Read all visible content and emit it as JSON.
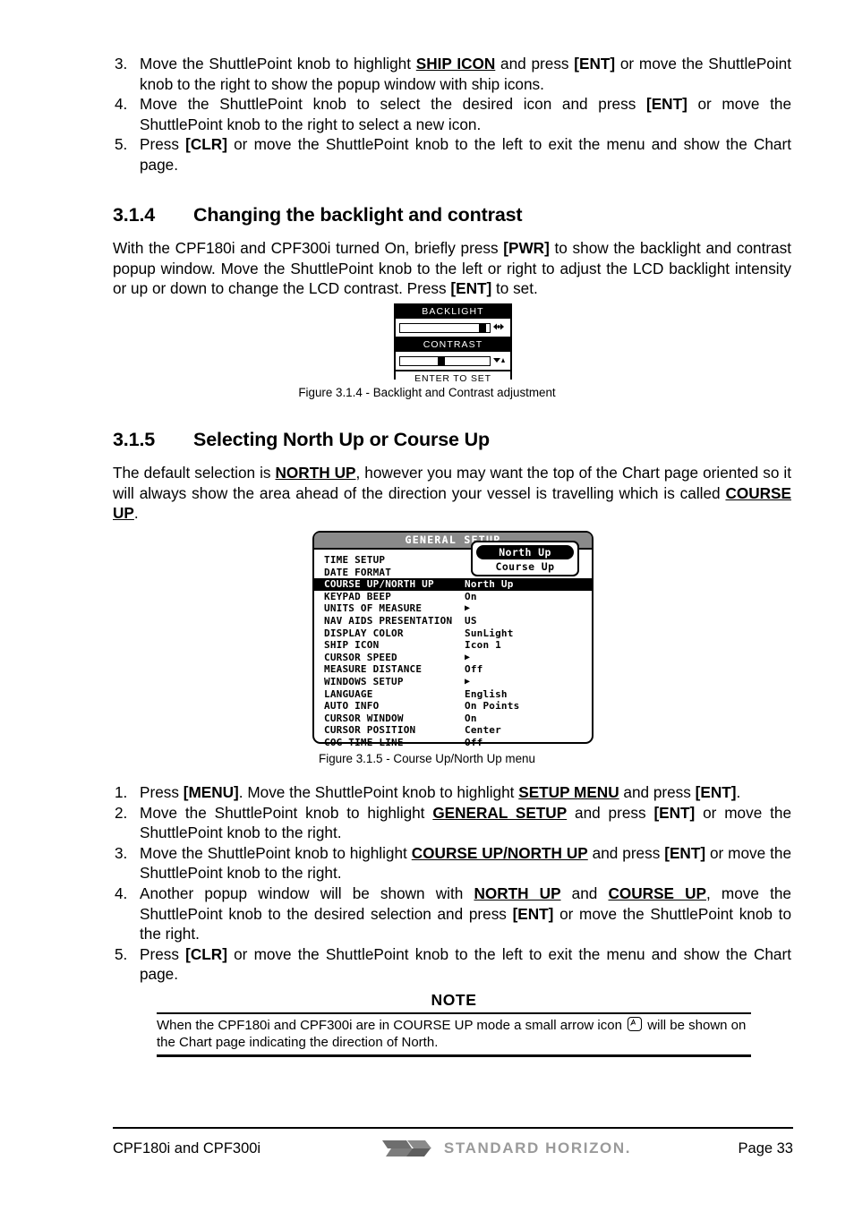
{
  "top_list": {
    "items": [
      {
        "marker": "3.",
        "segments": [
          {
            "t": "Move the ShuttlePoint knob to highlight ",
            "s": "normal"
          },
          {
            "t": "SHIP ICON",
            "s": "underline-bold"
          },
          {
            "t": " and press ",
            "s": "normal"
          },
          {
            "t": "[ENT]",
            "s": "bold"
          },
          {
            "t": " or move the ShuttlePoint knob to the right to show the popup window with ship icons.",
            "s": "normal"
          }
        ]
      },
      {
        "marker": "4.",
        "segments": [
          {
            "t": "Move the ShuttlePoint knob to select the desired icon and press ",
            "s": "normal"
          },
          {
            "t": "[ENT]",
            "s": "bold"
          },
          {
            "t": " or move the ShuttlePoint knob to the right to select a new icon.",
            "s": "normal"
          }
        ]
      },
      {
        "marker": "5.",
        "segments": [
          {
            "t": "Press ",
            "s": "normal"
          },
          {
            "t": "[CLR]",
            "s": "bold"
          },
          {
            "t": " or move the ShuttlePoint knob to the left to exit the menu and show the Chart page.",
            "s": "normal"
          }
        ]
      }
    ]
  },
  "section_314": {
    "number": "3.1.4",
    "title": "Changing the backlight and contrast",
    "paragraph": [
      {
        "t": "With the CPF180i and CPF300i turned On, briefly press ",
        "s": "normal"
      },
      {
        "t": "[PWR]",
        "s": "bold"
      },
      {
        "t": " to show the backlight and contrast popup window. Move the ShuttlePoint knob to the left or right to adjust the LCD backlight intensity or up or down to change the LCD contrast. Press ",
        "s": "normal"
      },
      {
        "t": "[ENT]",
        "s": "bold"
      },
      {
        "t": " to set.",
        "s": "normal"
      }
    ]
  },
  "backlight_figure": {
    "backlight_title": "BACKLIGHT",
    "backlight_knob_percent": 92,
    "backlight_side_icon": "brightness-icon",
    "contrast_title": "CONTRAST",
    "contrast_knob_percent": 46,
    "contrast_side_icon": "contrast-icon",
    "footer_label": "ENTER TO SET",
    "caption": "Figure 3.1.4 - Backlight and Contrast adjustment"
  },
  "section_315": {
    "number": "3.1.5",
    "title": "Selecting North Up or Course Up",
    "paragraph": [
      {
        "t": "The default selection is ",
        "s": "normal"
      },
      {
        "t": "NORTH UP",
        "s": "underline-bold"
      },
      {
        "t": ", however you may want the top of the Chart page oriented so it will always show the area ahead of the direction your vessel is travelling which is called ",
        "s": "normal"
      },
      {
        "t": "COURSE  UP",
        "s": "underline-bold"
      },
      {
        "t": ".",
        "s": "normal"
      }
    ]
  },
  "general_setup": {
    "title": "GENERAL SETUP",
    "rows": [
      {
        "label": "TIME SETUP",
        "value": "",
        "selected": false,
        "arrow": false
      },
      {
        "label": "DATE FORMAT",
        "value": "",
        "selected": false,
        "arrow": false
      },
      {
        "label": "COURSE UP/NORTH UP",
        "value": "North Up",
        "selected": true,
        "arrow": false
      },
      {
        "label": "KEYPAD BEEP",
        "value": "On",
        "selected": false,
        "arrow": false
      },
      {
        "label": "UNITS OF MEASURE",
        "value": "",
        "selected": false,
        "arrow": true
      },
      {
        "label": "NAV AIDS PRESENTATION",
        "value": "US",
        "selected": false,
        "arrow": false
      },
      {
        "label": "DISPLAY COLOR",
        "value": "SunLight",
        "selected": false,
        "arrow": false
      },
      {
        "label": "SHIP ICON",
        "value": "Icon 1",
        "selected": false,
        "arrow": false
      },
      {
        "label": "CURSOR SPEED",
        "value": "",
        "selected": false,
        "arrow": true
      },
      {
        "label": "MEASURE DISTANCE",
        "value": "Off",
        "selected": false,
        "arrow": false
      },
      {
        "label": "WINDOWS SETUP",
        "value": "",
        "selected": false,
        "arrow": true
      },
      {
        "label": "LANGUAGE",
        "value": "English",
        "selected": false,
        "arrow": false
      },
      {
        "label": "AUTO INFO",
        "value": "On Points",
        "selected": false,
        "arrow": false
      },
      {
        "label": "CURSOR WINDOW",
        "value": "On",
        "selected": false,
        "arrow": false
      },
      {
        "label": "CURSOR POSITION",
        "value": "Center",
        "selected": false,
        "arrow": false
      },
      {
        "label": "COG TIME LINE",
        "value": "Off",
        "selected": false,
        "arrow": false
      }
    ],
    "popup": {
      "options": [
        {
          "label": "North Up",
          "selected": true
        },
        {
          "label": "Course Up",
          "selected": false
        }
      ]
    },
    "caption": "Figure 3.1.5 - Course Up/North Up menu"
  },
  "bottom_list": {
    "items": [
      {
        "marker": "1.",
        "segments": [
          {
            "t": "Press ",
            "s": "normal"
          },
          {
            "t": "[MENU]",
            "s": "bold"
          },
          {
            "t": ". Move the ShuttlePoint knob to highlight ",
            "s": "normal"
          },
          {
            "t": "SETUP MENU",
            "s": "underline-bold"
          },
          {
            "t": " and press ",
            "s": "normal"
          },
          {
            "t": "[ENT]",
            "s": "bold"
          },
          {
            "t": ".",
            "s": "normal"
          }
        ]
      },
      {
        "marker": "2.",
        "segments": [
          {
            "t": "Move the ShuttlePoint knob to highlight ",
            "s": "normal"
          },
          {
            "t": "GENERAL SETUP",
            "s": "underline-bold"
          },
          {
            "t": " and press ",
            "s": "normal"
          },
          {
            "t": "[ENT]",
            "s": "bold"
          },
          {
            "t": " or move the ShuttlePoint knob to the right.",
            "s": "normal"
          }
        ]
      },
      {
        "marker": "3.",
        "segments": [
          {
            "t": "Move the ShuttlePoint knob to highlight  ",
            "s": "normal"
          },
          {
            "t": "COURSE UP/NORTH UP",
            "s": "underline-bold"
          },
          {
            "t": " and press ",
            "s": "normal"
          },
          {
            "t": "[ENT]",
            "s": "bold"
          },
          {
            "t": " or move the ShuttlePoint knob to the right.",
            "s": "normal"
          }
        ]
      },
      {
        "marker": "4.",
        "segments": [
          {
            "t": "Another popup window will be shown with ",
            "s": "normal"
          },
          {
            "t": "NORTH UP",
            "s": "underline-bold"
          },
          {
            "t": " and ",
            "s": "normal"
          },
          {
            "t": "COURSE UP",
            "s": "underline-bold"
          },
          {
            "t": ", move the ShuttlePoint knob to the desired selection and press ",
            "s": "normal"
          },
          {
            "t": "[ENT]",
            "s": "bold"
          },
          {
            "t": " or move the ShuttlePoint knob to the right.",
            "s": "normal"
          }
        ]
      },
      {
        "marker": "5.",
        "segments": [
          {
            "t": "Press ",
            "s": "normal"
          },
          {
            "t": "[CLR]",
            "s": "bold"
          },
          {
            "t": " or move the ShuttlePoint knob to the left to exit the menu and show the Chart page.",
            "s": "normal"
          }
        ]
      }
    ]
  },
  "note": {
    "title": "NOTE",
    "body_before_icon": "When the CPF180i and CPF300i are in COURSE UP mode a small arrow  icon ",
    "icon_name": "north-arrow-icon",
    "body_after_icon": " will be shown on the Chart page indicating the direction of North."
  },
  "footer": {
    "left": "CPF180i and CPF300i",
    "logo_text": "STANDARD HORIZON.",
    "logo_color": "#9a9a9a",
    "page": "Page 33"
  }
}
